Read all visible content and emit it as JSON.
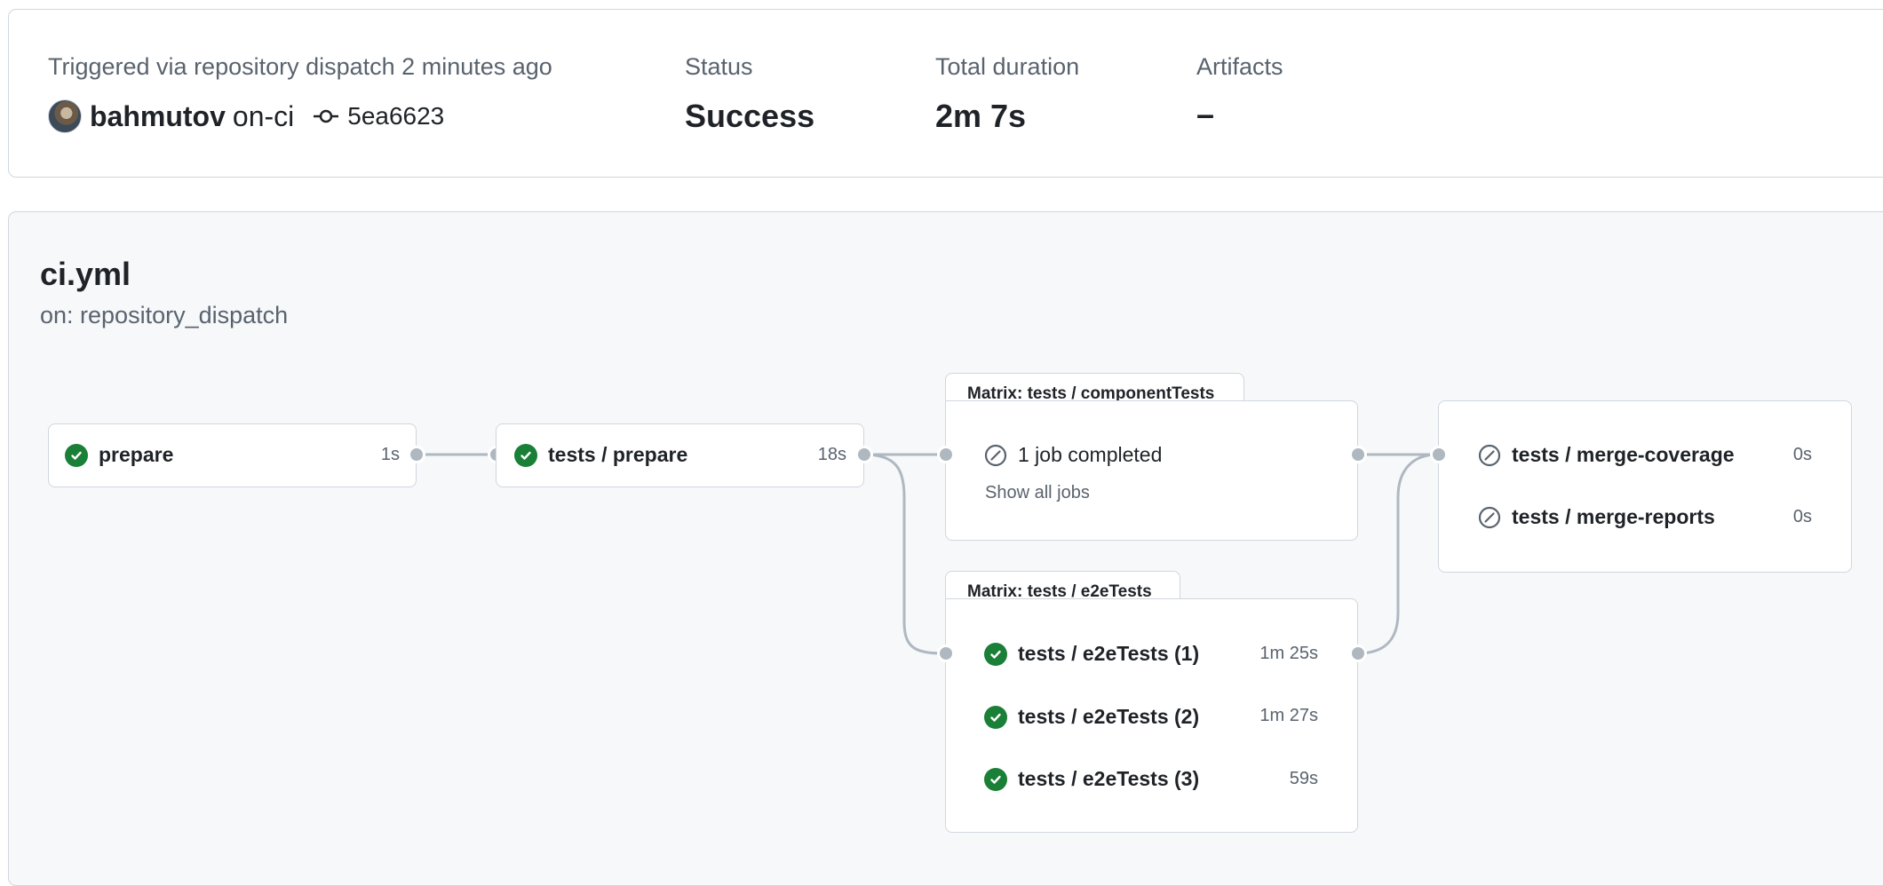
{
  "summary": {
    "trigger_text": "Triggered via repository dispatch 2 minutes ago",
    "actor": "bahmutov",
    "branch": "on-ci",
    "commit": "5ea6623",
    "status_label": "Status",
    "status_value": "Success",
    "duration_label": "Total duration",
    "duration_value": "2m 7s",
    "artifacts_label": "Artifacts",
    "artifacts_value": "–"
  },
  "workflow": {
    "file": "ci.yml",
    "trigger": "on: repository_dispatch"
  },
  "jobs": {
    "prepare": {
      "name": "prepare",
      "time": "1s",
      "status": "success"
    },
    "tests_prepare": {
      "name": "tests / prepare",
      "time": "18s",
      "status": "success"
    },
    "component_matrix": {
      "label": "Matrix: tests / componentTests",
      "summary": "1 job completed",
      "show_all": "Show all jobs",
      "status": "skipped"
    },
    "e2e_matrix": {
      "label": "Matrix: tests / e2eTests",
      "items": [
        {
          "name": "tests / e2eTests (1)",
          "time": "1m 25s",
          "status": "success"
        },
        {
          "name": "tests / e2eTests (2)",
          "time": "1m 27s",
          "status": "success"
        },
        {
          "name": "tests / e2eTests (3)",
          "time": "59s",
          "status": "success"
        }
      ]
    },
    "merge": {
      "items": [
        {
          "name": "tests / merge-coverage",
          "time": "0s",
          "status": "skipped"
        },
        {
          "name": "tests / merge-reports",
          "time": "0s",
          "status": "skipped"
        }
      ]
    }
  },
  "colors": {
    "success": "#1a7f37",
    "muted": "#59636e",
    "border": "#d0d7de",
    "connector": "#afb8c1"
  },
  "icons": {
    "success": "check-circle-fill-icon",
    "skipped": "skip-icon",
    "commit": "git-commit-icon"
  }
}
